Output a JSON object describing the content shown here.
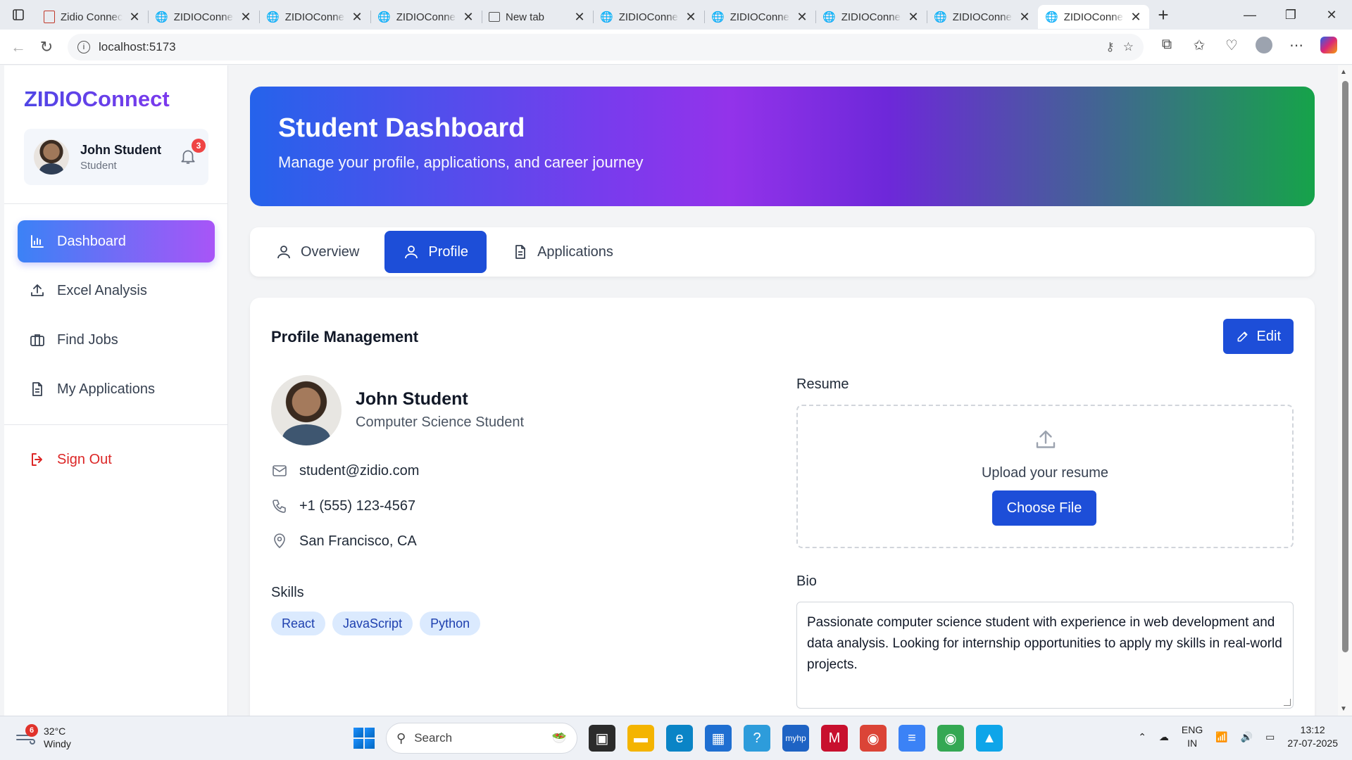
{
  "browser": {
    "tabs": [
      {
        "title": "Zidio Connect",
        "icon": "pdf-icon",
        "active": false
      },
      {
        "title": "ZIDIOConnect",
        "icon": "globe-icon",
        "active": false
      },
      {
        "title": "ZIDIOConnect",
        "icon": "globe-icon",
        "active": false
      },
      {
        "title": "ZIDIOConnect",
        "icon": "globe-icon",
        "active": false
      },
      {
        "title": "New tab",
        "icon": "newtab-icon",
        "active": false
      },
      {
        "title": "ZIDIOConnect",
        "icon": "globe-icon",
        "active": false
      },
      {
        "title": "ZIDIOConnect",
        "icon": "globe-icon",
        "active": false
      },
      {
        "title": "ZIDIOConnect",
        "icon": "globe-icon",
        "active": false
      },
      {
        "title": "ZIDIOConnect",
        "icon": "globe-icon",
        "active": false
      },
      {
        "title": "ZIDIOConnect",
        "icon": "globe-icon",
        "active": true
      }
    ],
    "url": "localhost:5173"
  },
  "sidebar": {
    "brand": "ZIDIOConnect",
    "user": {
      "name": "John Student",
      "role": "Student",
      "notifications": "3"
    },
    "items": [
      {
        "label": "Dashboard",
        "icon": "bar-chart-icon",
        "active": true
      },
      {
        "label": "Excel Analysis",
        "icon": "upload-icon",
        "active": false
      },
      {
        "label": "Find Jobs",
        "icon": "briefcase-icon",
        "active": false
      },
      {
        "label": "My Applications",
        "icon": "document-icon",
        "active": false
      }
    ],
    "signout": "Sign Out"
  },
  "hero": {
    "title": "Student Dashboard",
    "subtitle": "Manage your profile, applications, and career journey"
  },
  "tabs": [
    {
      "label": "Overview",
      "icon": "user-icon",
      "active": false
    },
    {
      "label": "Profile",
      "icon": "user-icon",
      "active": true
    },
    {
      "label": "Applications",
      "icon": "document-icon",
      "active": false
    }
  ],
  "profile": {
    "heading": "Profile Management",
    "edit_label": "Edit",
    "name": "John Student",
    "title": "Computer Science Student",
    "email": "student@zidio.com",
    "phone": "+1 (555) 123-4567",
    "location": "San Francisco, CA",
    "skills_label": "Skills",
    "skills": [
      "React",
      "JavaScript",
      "Python"
    ],
    "resume_label": "Resume",
    "upload_text": "Upload your resume",
    "choose_file": "Choose File",
    "bio_label": "Bio",
    "bio": "Passionate computer science student with experience in web development and data analysis. Looking for internship opportunities to apply my skills in real-world projects."
  },
  "taskbar": {
    "weather_temp": "32°C",
    "weather_desc": "Windy",
    "weather_badge": "6",
    "search_placeholder": "Search",
    "lang_top": "ENG",
    "lang_bottom": "IN",
    "time": "13:12",
    "date": "27-07-2025"
  }
}
